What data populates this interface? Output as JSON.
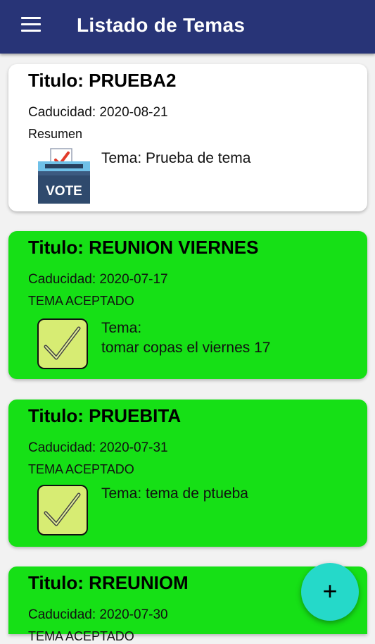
{
  "appbar": {
    "title": "Listado de Temas",
    "menu_icon": "hamburger-menu-icon",
    "color": "#283477"
  },
  "cards": [
    {
      "title": "Titulo: PRUEBA2",
      "expiry": "Caducidad: 2020-08-21",
      "status": "Resumen",
      "topic_line1": "Tema: Prueba de tema",
      "topic_line2": "",
      "icon": "vote-box-icon",
      "vote_label": "VOTE",
      "background": "#ffffff"
    },
    {
      "title": "Titulo: REUNION VIERNES",
      "expiry": "Caducidad: 2020-07-17",
      "status": "TEMA ACEPTADO",
      "topic_line1": "Tema:",
      "topic_line2": "tomar copas el viernes 17",
      "icon": "checkmark-icon",
      "background": "#16e016"
    },
    {
      "title": "Titulo: PRUEBITA",
      "expiry": "Caducidad: 2020-07-31",
      "status": "TEMA ACEPTADO",
      "topic_line1": "Tema: tema de ptueba",
      "topic_line2": "",
      "icon": "checkmark-icon",
      "background": "#16e016"
    },
    {
      "title": "Titulo: RREUNIOM",
      "expiry": "Caducidad: 2020-07-30",
      "status": "TEMA ACEPTADO",
      "background": "#16e016"
    }
  ],
  "fab": {
    "label": "+",
    "icon": "add-icon",
    "color": "#25d9c9"
  }
}
